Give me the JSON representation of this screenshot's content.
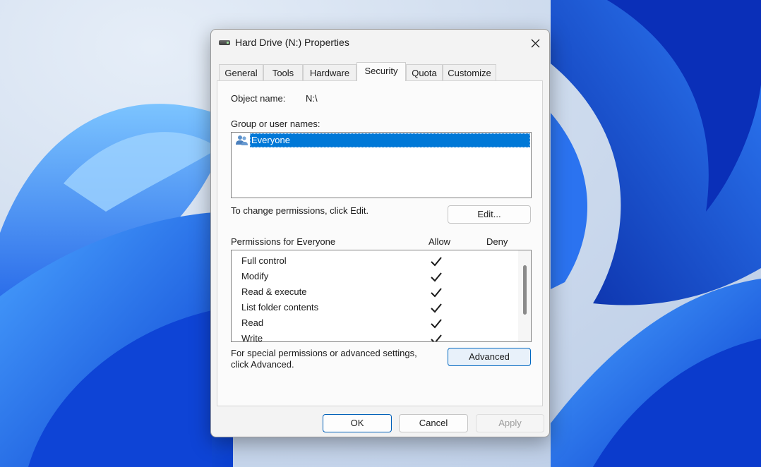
{
  "dialog": {
    "title": "Hard Drive (N:) Properties",
    "icons": {
      "title": "drive-icon",
      "close": "close-icon"
    }
  },
  "tabs": [
    {
      "label": "General"
    },
    {
      "label": "Tools"
    },
    {
      "label": "Hardware"
    },
    {
      "label": "Security",
      "active": true
    },
    {
      "label": "Quota"
    },
    {
      "label": "Customize"
    }
  ],
  "security": {
    "object_name_label": "Object name:",
    "object_name_value": "N:\\",
    "group_label": "Group or user names:",
    "users": [
      {
        "name": "Everyone",
        "icon": "users-icon",
        "selected": true
      }
    ],
    "change_text": "To change permissions, click Edit.",
    "edit_button": "Edit...",
    "permissions_for": "Permissions for Everyone",
    "allow_header": "Allow",
    "deny_header": "Deny",
    "permissions": [
      {
        "name": "Full control",
        "allow": true,
        "deny": false
      },
      {
        "name": "Modify",
        "allow": true,
        "deny": false
      },
      {
        "name": "Read & execute",
        "allow": true,
        "deny": false
      },
      {
        "name": "List folder contents",
        "allow": true,
        "deny": false
      },
      {
        "name": "Read",
        "allow": true,
        "deny": false
      },
      {
        "name": "Write",
        "allow": true,
        "deny": false
      }
    ],
    "special_text_line1": "For special permissions or advanced settings,",
    "special_text_line2": "click Advanced.",
    "advanced_button": "Advanced"
  },
  "footer": {
    "ok": "OK",
    "cancel": "Cancel",
    "apply": "Apply"
  },
  "colors": {
    "accent": "#0078d7",
    "wallpaper_primary": "#1a5fe8"
  }
}
